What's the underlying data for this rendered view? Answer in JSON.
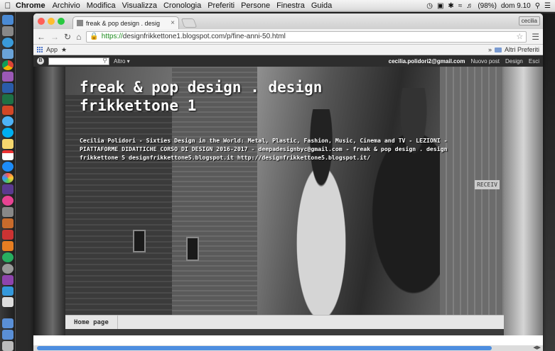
{
  "menubar": {
    "app": "Chrome",
    "items": [
      "Archivio",
      "Modifica",
      "Visualizza",
      "Cronologia",
      "Preferiti",
      "Persone",
      "Finestra",
      "Guida"
    ],
    "battery": "(98%)",
    "clock": "dom 9.10"
  },
  "browser": {
    "tab_title": "freak & pop design . desig",
    "user": "cecilia",
    "url_https": "https://",
    "url_rest": "designfrikkettone1.blogspot.com/p/fine-anni-50.html",
    "bookmarks": {
      "apps": "App",
      "other": "Altri Preferiti"
    }
  },
  "blogger": {
    "altro": "Altro ▾",
    "email": "cecilia.polidori2@gmail.com",
    "new_post": "Nuovo post",
    "design": "Design",
    "exit": "Esci"
  },
  "blog": {
    "title": "freak & pop design . design frikkettone 1",
    "description": "Cecilia Polidori - Sixties Design in the World: Metal, Plastic, Fashion, Music, Cinema and TV - LEZIONI - PIATTAFORME DIDATTICHE CORSO DI DESIGN 2016-2017 - deepadesignbyc@gmail.com - freak & pop design . design frikkettone 5 designfrikkettone5.blogspot.it http://designfrikkettone5.blogspot.it/",
    "sign": "RECEIV",
    "nav": [
      "Home page"
    ]
  },
  "colors": {
    "scroll_thumb": "#4d8ee0",
    "traffic_close": "#ff5f57",
    "traffic_min": "#ffbd2e",
    "traffic_max": "#28c940"
  }
}
